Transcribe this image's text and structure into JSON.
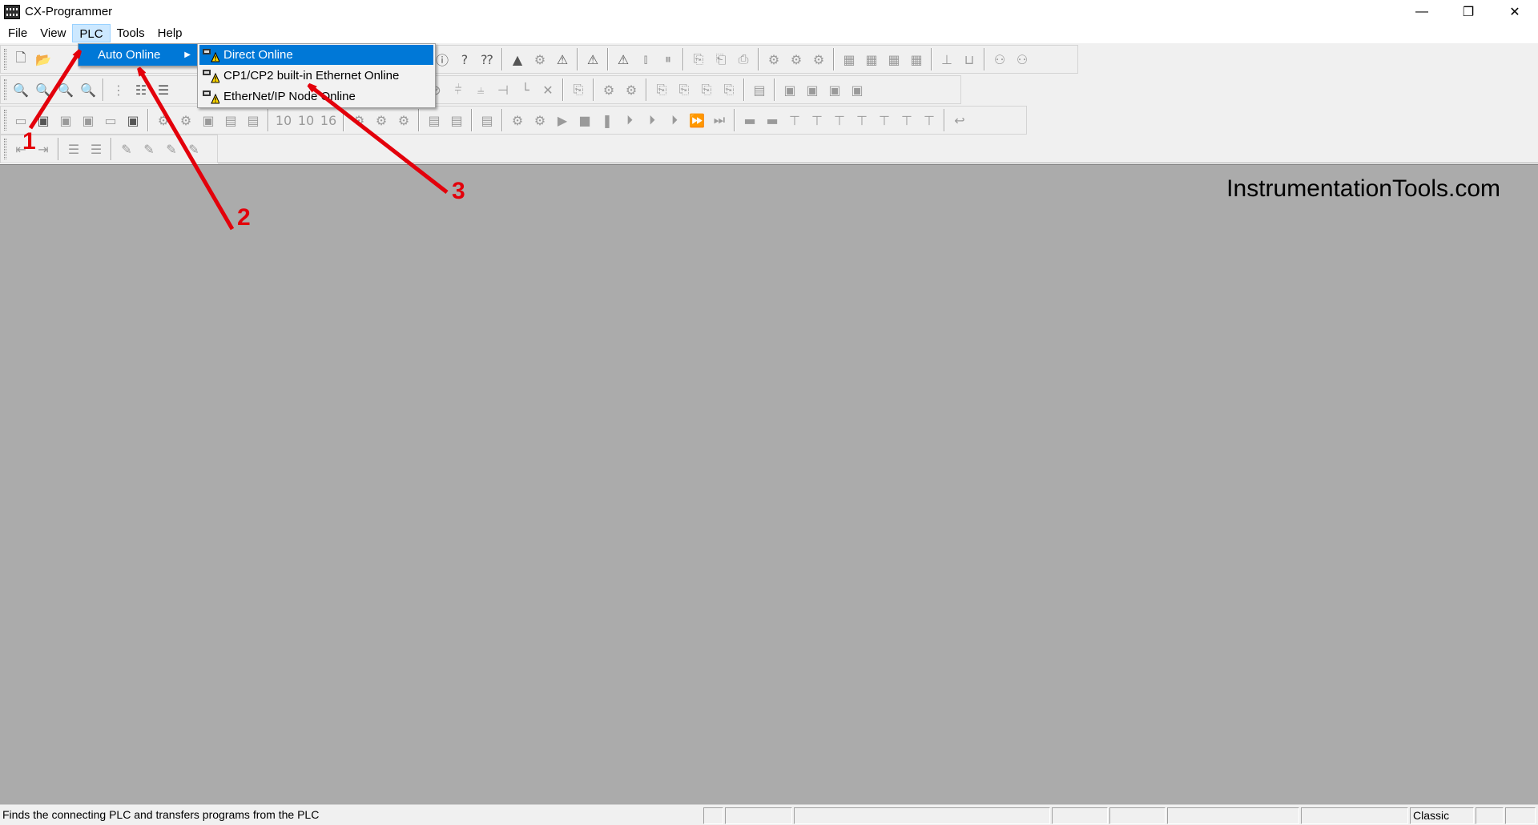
{
  "window": {
    "title": "CX-Programmer",
    "controls": [
      "—",
      "❐",
      "✕"
    ]
  },
  "menubar": {
    "items": [
      "File",
      "View",
      "PLC",
      "Tools",
      "Help"
    ]
  },
  "plc_menu": {
    "items": [
      {
        "label": "Auto Online",
        "has_submenu": true
      }
    ]
  },
  "auto_online_submenu": {
    "items": [
      {
        "label": "Direct Online",
        "icon": "direct-online-icon"
      },
      {
        "label": "CP1/CP2 built-in Ethernet Online",
        "icon": "ethernet-online-icon"
      },
      {
        "label": "EtherNet/IP Node Online",
        "icon": "ethernetip-online-icon"
      }
    ]
  },
  "workspace": {
    "watermark": "InstrumentationTools.com",
    "background": "#ababab"
  },
  "statusbar": {
    "message": "Finds the connecting PLC and transfers programs from the PLC",
    "mode": "Classic"
  },
  "annotations": {
    "color": "#e3000b",
    "labels": [
      "1",
      "2",
      "3"
    ]
  },
  "colors": {
    "highlight": "#0078d7",
    "menu_active": "#cce8ff",
    "toolbar_bg": "#f0f0f0"
  }
}
